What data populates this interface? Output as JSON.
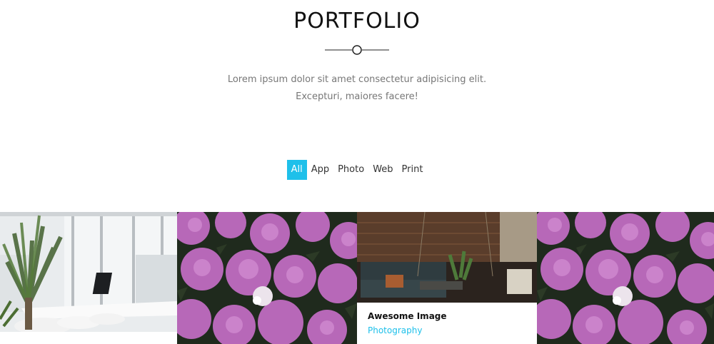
{
  "header": {
    "title": "PORTFOLIO",
    "subtitle": "Lorem ipsum dolor sit amet consectetur adipisicing elit. Excepturi, maiores facere!"
  },
  "filters": [
    {
      "label": "All",
      "active": true
    },
    {
      "label": "App",
      "active": false
    },
    {
      "label": "Photo",
      "active": false
    },
    {
      "label": "Web",
      "active": false
    },
    {
      "label": "Print",
      "active": false
    }
  ],
  "portfolio": {
    "items": [
      {
        "image": "office-photo"
      },
      {
        "image": "hydrangea-photo"
      },
      {
        "image": "lounge-photo",
        "caption_title": "Awesome Image",
        "caption_category": "Photography"
      },
      {
        "image": "hydrangea-photo"
      }
    ]
  },
  "colors": {
    "accent": "#1ec0ea"
  }
}
